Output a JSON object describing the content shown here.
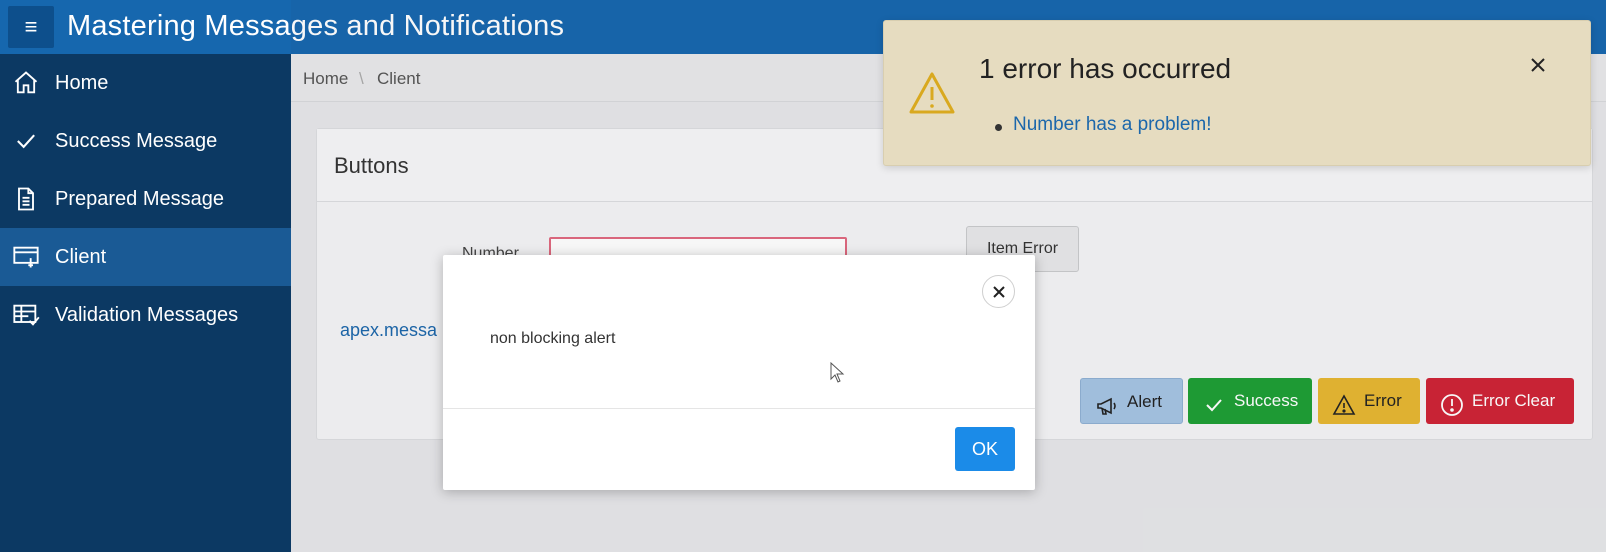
{
  "header": {
    "title": "Mastering Messages and Notifications",
    "menu_icon": "hamburger-icon"
  },
  "sidebar": {
    "items": [
      {
        "label": "Home",
        "icon": "home-icon"
      },
      {
        "label": "Success Message",
        "icon": "check-icon"
      },
      {
        "label": "Prepared Message",
        "icon": "document-icon"
      },
      {
        "label": "Client",
        "icon": "client-icon",
        "active": true
      },
      {
        "label": "Validation Messages",
        "icon": "table-check-icon"
      }
    ]
  },
  "breadcrumb": {
    "items": [
      "Home",
      "Client"
    ],
    "separator": "\\"
  },
  "region": {
    "title": "Buttons",
    "field_label": "Number",
    "item_error_label": "Item Error",
    "link_text": "apex.messa",
    "buttons": {
      "alert": "Alert",
      "success": "Success",
      "error": "Error",
      "error_clear": "Error Clear"
    }
  },
  "dialog": {
    "message": "non blocking alert",
    "ok_label": "OK"
  },
  "notification": {
    "title": "1 error has occurred",
    "errors": [
      "Number has a problem!"
    ]
  },
  "colors": {
    "header": "#1667ae",
    "sidebar": "#0c3963",
    "sidebar_active": "#1a5a95",
    "success": "#1e9f35",
    "warning": "#e6b731",
    "danger": "#cf2336",
    "notification_bg": "#e6dcc0"
  }
}
